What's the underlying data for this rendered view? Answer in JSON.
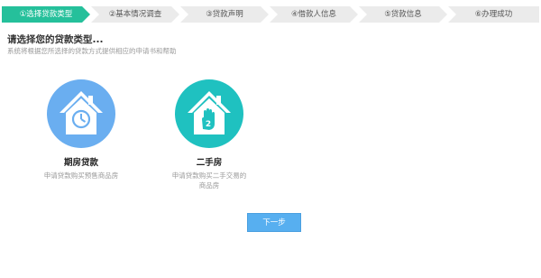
{
  "steps": [
    {
      "label": "①选择贷款类型"
    },
    {
      "label": "②基本情况调查"
    },
    {
      "label": "③贷款声明"
    },
    {
      "label": "④借款人信息"
    },
    {
      "label": "⑤贷款信息"
    },
    {
      "label": "⑥办理成功"
    }
  ],
  "page": {
    "title": "请选择您的贷款类型...",
    "subtitle": "系统将根据您所选择的贷款方式提供相应的申请书和帮助"
  },
  "options": [
    {
      "title": "期房贷款",
      "desc": "申请贷款购买预售商品房",
      "color": "#6aaef0",
      "icon": "clock-house-icon"
    },
    {
      "title": "二手房",
      "desc": "申请贷款购买二手交易的商品房",
      "color": "#1fc1c0",
      "icon": "hand-2-house-icon",
      "badge": "2"
    }
  ],
  "actions": {
    "next_label": "下一步"
  },
  "colors": {
    "active_step": "#25c09b",
    "button": "#57aff0"
  }
}
